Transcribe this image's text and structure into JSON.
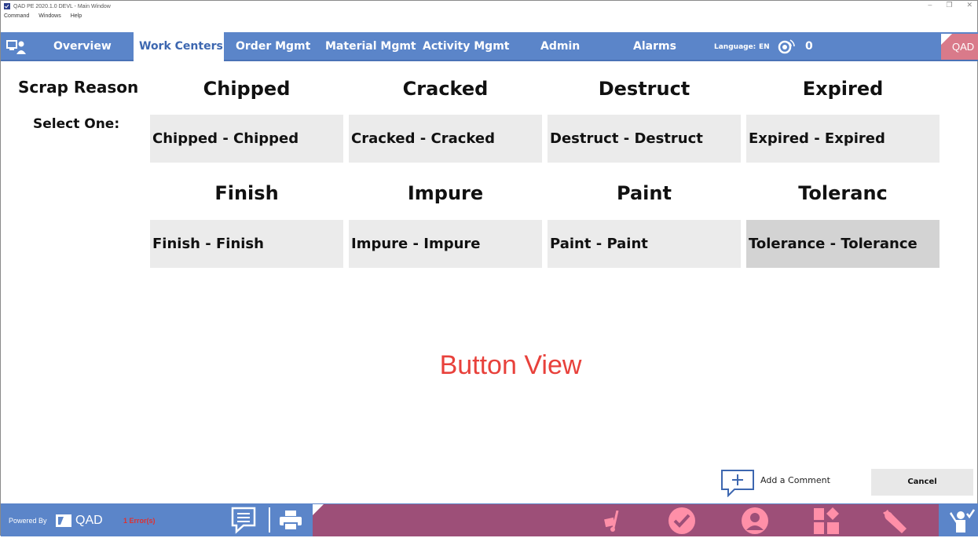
{
  "window": {
    "title": "QAD PE 2020.1.0 DEVL - Main Window",
    "menu": [
      "Command",
      "Windows",
      "Help"
    ]
  },
  "nav": {
    "items": [
      "Overview",
      "Work Centers",
      "Order Mgmt",
      "Material Mgmt",
      "Activity Mgmt",
      "Admin",
      "Alarms"
    ],
    "active": "Work Centers",
    "language_label": "Language:",
    "language_value": "EN",
    "alarm_count": "0",
    "brand": "QAD"
  },
  "content": {
    "title": "Scrap Reason",
    "subtitle": "Select One:",
    "reasons": [
      {
        "heading": "Chipped",
        "button": "Chipped - Chipped"
      },
      {
        "heading": "Cracked",
        "button": "Cracked - Cracked"
      },
      {
        "heading": "Destruct",
        "button": "Destruct - Destruct"
      },
      {
        "heading": "Expired",
        "button": "Expired - Expired"
      },
      {
        "heading": "Finish",
        "button": "Finish - Finish"
      },
      {
        "heading": "Impure",
        "button": "Impure - Impure"
      },
      {
        "heading": "Paint",
        "button": "Paint - Paint"
      },
      {
        "heading": "Toleranc",
        "button": "Tolerance - Tolerance"
      }
    ],
    "selected_index": 7,
    "view_label": "Button  View",
    "add_comment": "Add a Comment",
    "cancel": "Cancel"
  },
  "footer": {
    "powered_by": "Powered By",
    "brand": "QAD",
    "errors": "1 Error(s)",
    "icons": [
      "comment-icon",
      "print-icon",
      "hand-truck-icon",
      "check-circle-icon",
      "user-circle-icon",
      "layout-icon",
      "wrench-icon",
      "person-raise-hand-icon"
    ]
  },
  "colors": {
    "nav_blue": "#5b85c9",
    "active_tab_text": "#3d67b0",
    "action_bar": "#9d4f78",
    "accent_pink": "#ff8fa8",
    "watermark_red": "#e8413b",
    "error_red": "#e03030"
  }
}
